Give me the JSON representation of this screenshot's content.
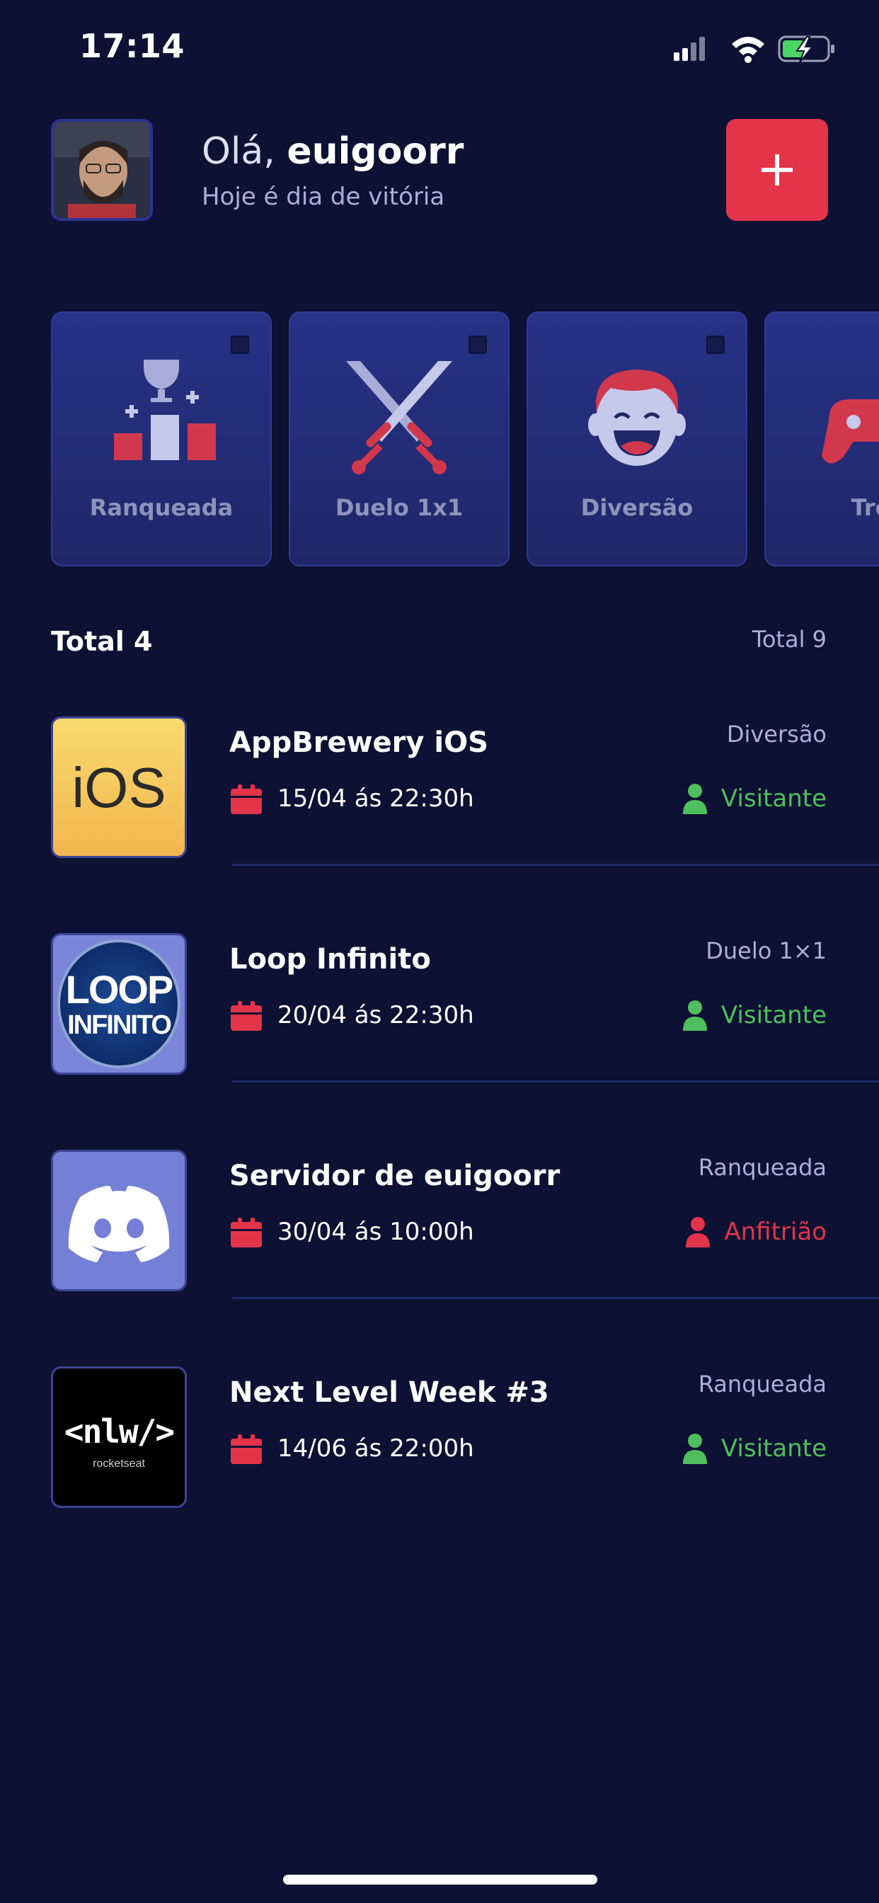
{
  "status_bar": {
    "time": "17:14"
  },
  "header": {
    "greeting_prefix": "Olá,",
    "username": "euigoorr",
    "subtitle": "Hoje é dia de vitória"
  },
  "categories": [
    {
      "label": "Ranqueada",
      "icon": "podium-trophy-icon"
    },
    {
      "label": "Duelo 1x1",
      "icon": "crossed-swords-icon"
    },
    {
      "label": "Diversão",
      "icon": "laughing-face-icon"
    },
    {
      "label": "Trei",
      "icon": "game-controller-icon"
    }
  ],
  "totals": {
    "left": "Total 4",
    "right": "Total 9"
  },
  "appointments": [
    {
      "guild": "AppBrewery iOS",
      "category": "Diversão",
      "date": "15/04 ás 22:30h",
      "role": "Visitante",
      "thumb_text": "iOS"
    },
    {
      "guild": "Loop Infinito",
      "category": "Duelo 1×1",
      "date": "20/04 ás 22:30h",
      "role": "Visitante",
      "thumb_text_1": "LOOP",
      "thumb_text_2": "INFINITO"
    },
    {
      "guild": "Servidor de euigoorr",
      "category": "Ranqueada",
      "date": "30/04 ás 10:00h",
      "role": "Anfitrião"
    },
    {
      "guild": "Next Level Week #3",
      "category": "Ranqueada",
      "date": "14/06 ás 22:00h",
      "role": "Visitante",
      "thumb_text": "<nlw/>",
      "thumb_sub": "rocketseat"
    }
  ],
  "colors": {
    "background": "#0d1133",
    "accent": "#e3344a",
    "visitor": "#4fbf5e",
    "host": "#e3344a"
  }
}
